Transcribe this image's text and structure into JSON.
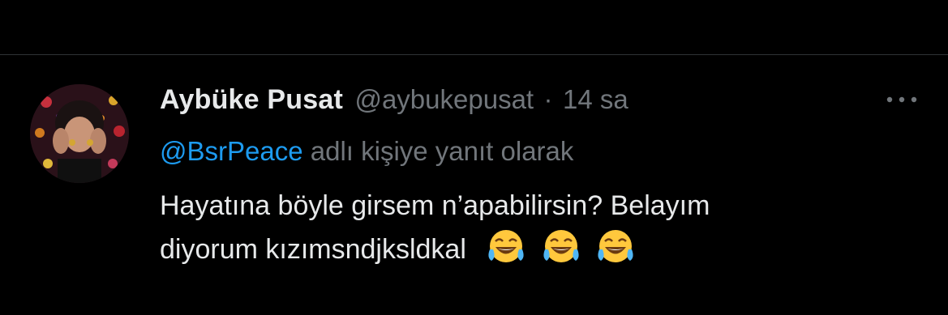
{
  "tweet": {
    "display_name": "Aybüke Pusat",
    "handle": "@aybukepusat",
    "separator": "·",
    "time": "14 sa",
    "reply_mention": "@BsrPeace",
    "reply_suffix": "adlı kişiye yanıt olarak",
    "text_line1": "Hayatına böyle girsem n’apabilirsin? Belayım",
    "text_line2": "diyorum kızımsndjksldkal",
    "emojis": [
      "face-with-tears-of-joy-icon",
      "face-with-tears-of-joy-icon",
      "face-with-tears-of-joy-icon"
    ]
  },
  "colors": {
    "background": "#000000",
    "primary_text": "#e7e9ea",
    "secondary_text": "#71767b",
    "link": "#1d9bf0",
    "divider": "#2f3336",
    "emoji_face": "#ffc83d",
    "emoji_tears": "#4fb6f5"
  }
}
